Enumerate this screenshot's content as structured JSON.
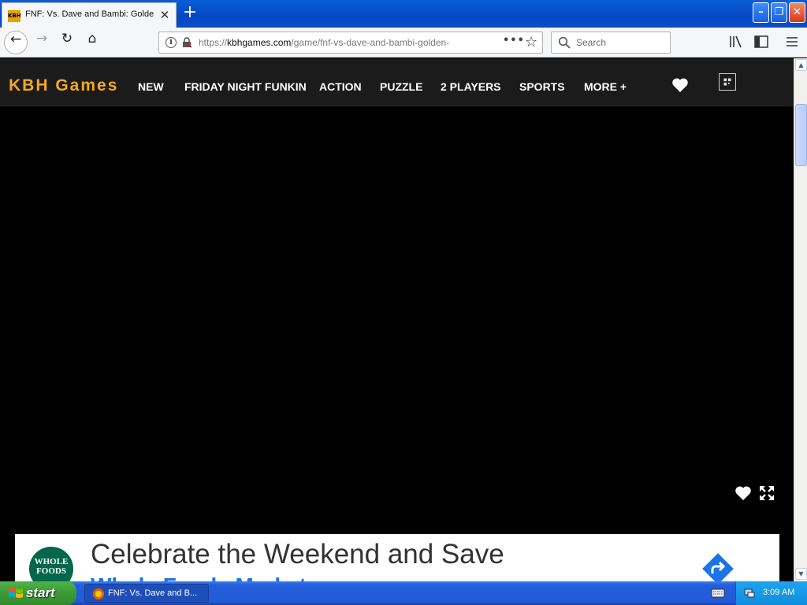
{
  "browser": {
    "tab": {
      "favicon_text": "KBH",
      "title": "FNF: Vs. Dave and Bambi: Golden"
    },
    "url": {
      "prefix": "https://",
      "host": "kbhgames.com",
      "path": "/game/fnf-vs-dave-and-bambi-golden-"
    },
    "search": {
      "placeholder": "Search"
    },
    "page_actions_label": "•••"
  },
  "site": {
    "logo": "KBH Games",
    "nav": [
      "NEW",
      "FRIDAY NIGHT FUNKIN",
      "ACTION",
      "PUZZLE",
      "2 PLAYERS",
      "SPORTS",
      "MORE +"
    ]
  },
  "ad": {
    "logo_line1": "WHOLE",
    "logo_line2": "FOODS",
    "headline": "Celebrate the Weekend and Save",
    "subline": "Whole Foods Market"
  },
  "taskbar": {
    "start_label": "start",
    "item_label": "FNF: Vs. Dave and B...",
    "clock": "3:09 AM"
  },
  "colors": {
    "logo_accent": "#f2a91e",
    "header_bg": "#1b1b1b",
    "ad_brand": "#00674b"
  },
  "icons": [
    "back-arrow-icon",
    "forward-arrow-icon",
    "reload-icon",
    "home-icon",
    "info-icon",
    "lock-icon",
    "star-icon",
    "search-icon",
    "library-icon",
    "sidebar-icon",
    "menu-icon",
    "heart-icon",
    "qr-icon",
    "fullscreen-icon",
    "share-arrow-icon",
    "windows-flag-icon"
  ]
}
